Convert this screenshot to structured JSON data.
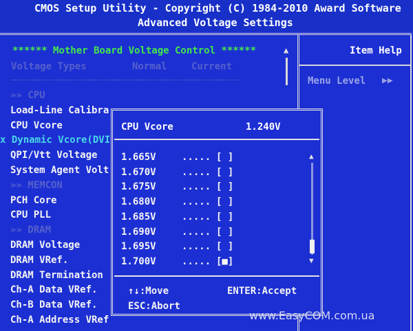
{
  "header": {
    "title": "CMOS Setup Utility - Copyright (C) 1984-2010 Award Software",
    "subtitle": "Advanced Voltage Settings"
  },
  "left_panel": {
    "section_title": "****** Mother Board Voltage Control ******",
    "columns": [
      "Voltage Types",
      "Normal",
      "Current"
    ],
    "items": [
      {
        "label": "»» CPU",
        "style": "dim"
      },
      {
        "label": "Load-Line Calibra",
        "style": "normal"
      },
      {
        "label": "CPU Vcore",
        "style": "normal"
      },
      {
        "label": "x Dynamic Vcore(DVI",
        "style": "cyan"
      },
      {
        "label": "QPI/Vtt Voltage",
        "style": "normal"
      },
      {
        "label": "System Agent Volt",
        "style": "normal"
      },
      {
        "label": "»» MEMCON",
        "style": "dim"
      },
      {
        "label": "PCH Core",
        "style": "normal"
      },
      {
        "label": "CPU PLL",
        "style": "normal"
      },
      {
        "label": "»» DRAM",
        "style": "dim"
      },
      {
        "label": "DRAM Voltage",
        "style": "normal"
      },
      {
        "label": "DRAM VRef.",
        "style": "normal"
      },
      {
        "label": "DRAM Termination",
        "style": "normal"
      },
      {
        "label": "Ch-A Data VRef.",
        "style": "normal"
      },
      {
        "label": "Ch-B Data VRef.",
        "style": "normal"
      },
      {
        "label": "Ch-A Address VRef",
        "style": "normal"
      }
    ]
  },
  "help_panel": {
    "title": "Item Help",
    "menu_level": "Menu Level",
    "menu_level_arrows": "▶▶"
  },
  "popup": {
    "title": "CPU Vcore",
    "value": "1.240V",
    "options": [
      {
        "value": "1.665V",
        "dots": ".....",
        "mark": "[ ]"
      },
      {
        "value": "1.670V",
        "dots": ".....",
        "mark": "[ ]"
      },
      {
        "value": "1.675V",
        "dots": ".....",
        "mark": "[ ]"
      },
      {
        "value": "1.680V",
        "dots": ".....",
        "mark": "[ ]"
      },
      {
        "value": "1.685V",
        "dots": ".....",
        "mark": "[ ]"
      },
      {
        "value": "1.690V",
        "dots": ".....",
        "mark": "[ ]"
      },
      {
        "value": "1.695V",
        "dots": ".....",
        "mark": "[ ]"
      },
      {
        "value": "1.700V",
        "dots": ".....",
        "mark": "[■]"
      }
    ],
    "keys": {
      "move": "↑↓:Move",
      "accept": "ENTER:Accept",
      "abort": "ESC:Abort"
    }
  },
  "watermark": "www.EasyCOM.com.ua"
}
